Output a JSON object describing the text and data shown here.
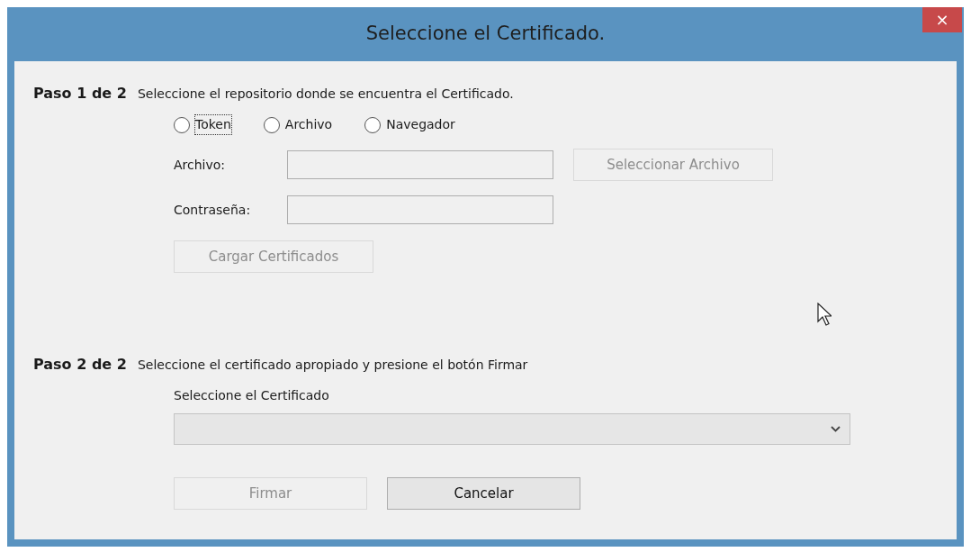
{
  "window": {
    "title": "Seleccione el Certificado.",
    "close": "×"
  },
  "step1": {
    "heading": "Paso 1 de 2",
    "instruction": "Seleccione el repositorio donde se encuentra el Certificado.",
    "radios": [
      {
        "label": "Token",
        "selected": false,
        "focused": true
      },
      {
        "label": "Archivo",
        "selected": false,
        "focused": false
      },
      {
        "label": "Navegador",
        "selected": false,
        "focused": false
      }
    ],
    "file_label": "Archivo:",
    "file_button": {
      "label": "Seleccionar Archivo",
      "disabled": true
    },
    "password_label": "Contraseña:",
    "load_button": {
      "label": "Cargar Certificados",
      "disabled": true
    }
  },
  "step2": {
    "heading": "Paso 2 de 2",
    "instruction": "Seleccione el certificado apropiado y presione el botón Firmar",
    "select_label": "Seleccione el Certificado",
    "buttons": [
      {
        "label": "Firmar",
        "disabled": true
      },
      {
        "label": "Cancelar",
        "disabled": false
      }
    ]
  }
}
